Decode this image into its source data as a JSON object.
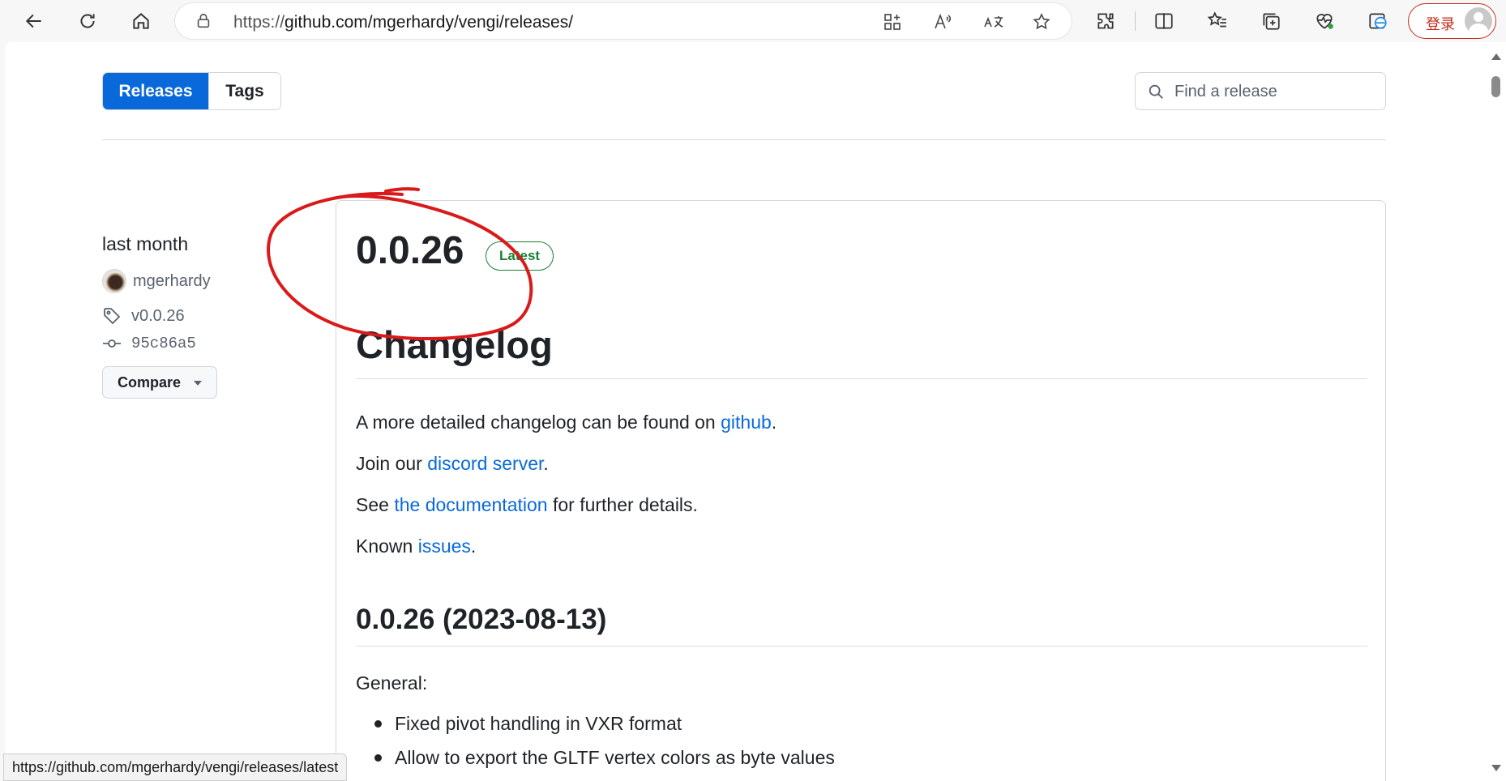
{
  "browser": {
    "url_prefix": "https://",
    "url_main": "github.com/mgerhardy/vengi/releases/",
    "login_label": "登录",
    "status_url": "https://github.com/mgerhardy/vengi/releases/latest"
  },
  "subnav": {
    "releases_label": "Releases",
    "tags_label": "Tags",
    "search_placeholder": "Find a release"
  },
  "release": {
    "date": "last month",
    "author": "mgerhardy",
    "tag": "v0.0.26",
    "commit": "95c86a5",
    "compare_label": "Compare",
    "title": "0.0.26",
    "badge": "Latest"
  },
  "body": {
    "changelog_heading": "Changelog",
    "p1": {
      "before": "A more detailed changelog can be found on ",
      "link": "github",
      "after": "."
    },
    "p2": {
      "before": "Join our ",
      "link": "discord server",
      "after": "."
    },
    "p3": {
      "before": "See ",
      "link": "the documentation",
      "after": " for further details."
    },
    "p4": {
      "before": "Known ",
      "link": "issues",
      "after": "."
    },
    "version_heading": "0.0.26 (2023-08-13)",
    "general_label": "General:",
    "bullets": [
      "Fixed pivot handling in VXR format",
      "Allow to export the GLTF vertex colors as byte values"
    ]
  },
  "colors": {
    "accent": "#0969da",
    "latest_badge": "#1a7f37",
    "annotation": "#d91a1a"
  }
}
